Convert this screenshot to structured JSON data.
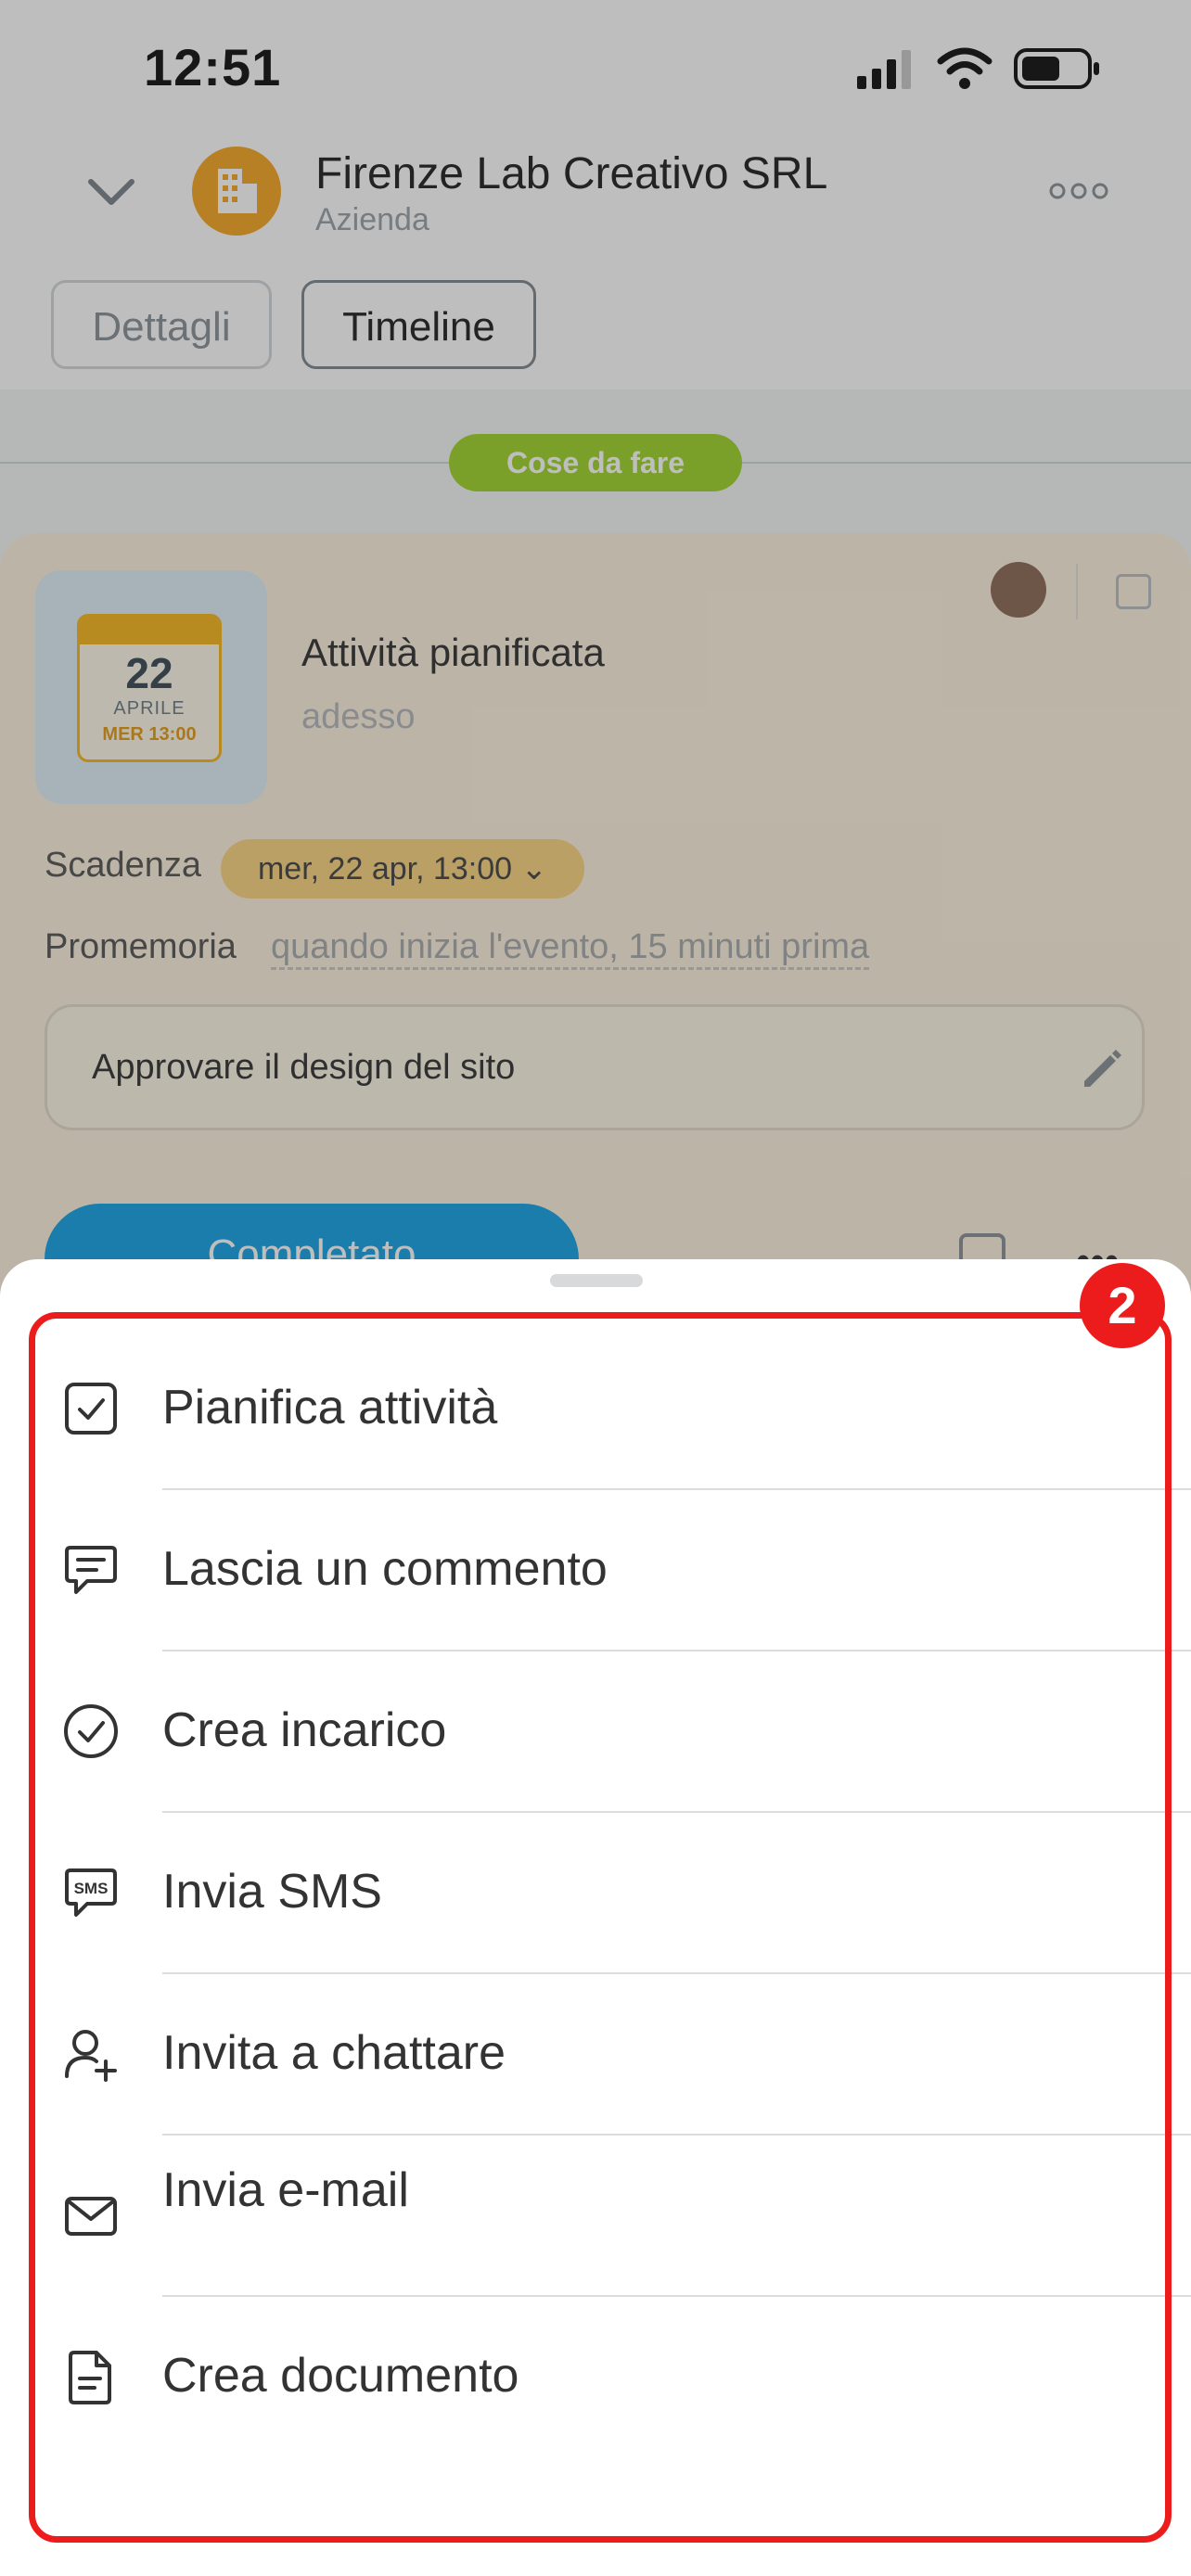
{
  "status_bar": {
    "time": "12:51"
  },
  "header": {
    "company_name": "Firenze Lab Creativo SRL",
    "company_type": "Azienda",
    "icons": [
      "chevron-down-icon",
      "building-icon",
      "more-icon"
    ]
  },
  "tabs": [
    {
      "label": "Dettagli",
      "active": false
    },
    {
      "label": "Timeline",
      "active": true
    }
  ],
  "timeline": {
    "section_pill": "Cose da fare"
  },
  "activity": {
    "calendar": {
      "day": "22",
      "month": "APRILE",
      "when": "MER 13:00"
    },
    "title": "Attività pianificata",
    "subtitle": "adesso",
    "deadline_label": "Scadenza",
    "deadline_value": "mer, 22 apr, 13:00",
    "reminder_label": "Promemoria",
    "reminder_value": "quando inizia l'evento, 15 minuti prima",
    "description": "Approvare il design del sito",
    "complete_button": "Completato"
  },
  "menu": {
    "items": [
      {
        "label": "Pianifica attività",
        "icon": "checkbox-icon"
      },
      {
        "label": "Lascia un commento",
        "icon": "comment-icon"
      },
      {
        "label": "Crea incarico",
        "icon": "check-circle-icon"
      },
      {
        "label": "Invia SMS",
        "icon": "sms-icon"
      },
      {
        "label": "Invita a chattare",
        "icon": "user-add-icon"
      },
      {
        "label": "Invia e-mail",
        "icon": "envelope-icon"
      },
      {
        "label": "Crea documento",
        "icon": "document-icon"
      }
    ]
  },
  "annotation": {
    "badge": "2",
    "color": "#ec1c1c"
  },
  "colors": {
    "accent_blue": "#16a3e6",
    "pill_green": "#9fd42b",
    "logo_orange": "#f5a623",
    "deadline_badge": "#fbd482"
  }
}
